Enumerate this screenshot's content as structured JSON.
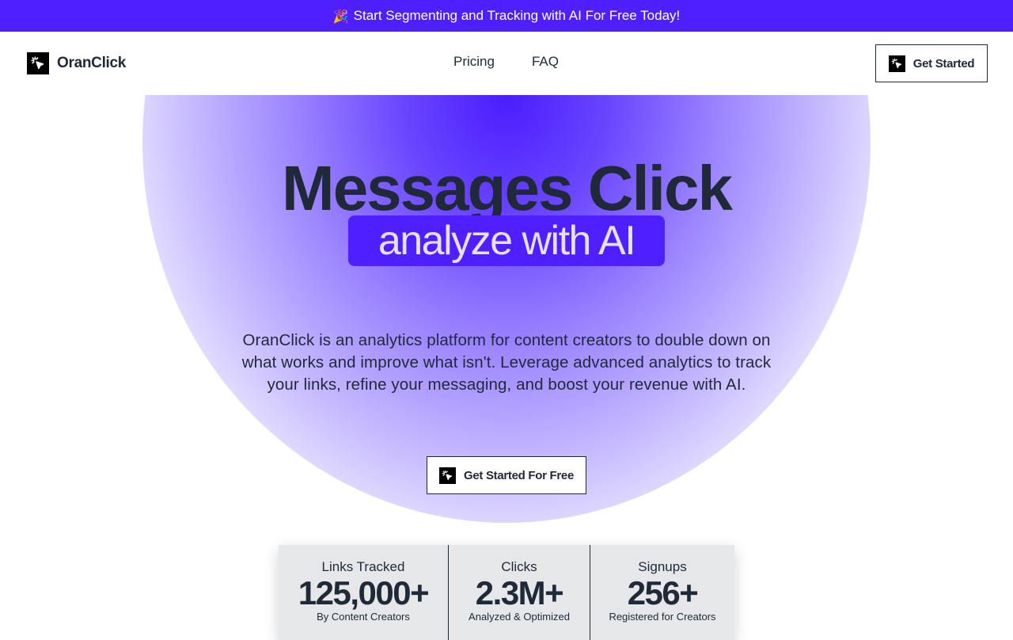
{
  "banner": {
    "emoji": "🎉",
    "text": "Start Segmenting and Tracking with AI For Free Today!"
  },
  "nav": {
    "brand": "OranClick",
    "logo_icon": "cursor-click-icon",
    "links": [
      "Pricing",
      "FAQ"
    ],
    "cta": "Get Started"
  },
  "hero": {
    "headline": "Messages Click",
    "tag": "analyze with AI",
    "description": "OranClick is an analytics platform for content creators to double down on what works and improve what isn't. Leverage advanced analytics to track your links, refine your messaging, and boost your revenue with AI.",
    "cta": "Get Started For Free"
  },
  "stats": [
    {
      "label": "Links Tracked",
      "value": "125,000+",
      "sub": "By Content Creators"
    },
    {
      "label": "Clicks",
      "value": "2.3M+",
      "sub": "Analyzed & Optimized"
    },
    {
      "label": "Signups",
      "value": "256+",
      "sub": "Registered for Creators"
    }
  ],
  "colors": {
    "brand_purple": "#4f1fff",
    "text_dark": "#1f2937",
    "stats_bg": "#e5e7e8"
  }
}
